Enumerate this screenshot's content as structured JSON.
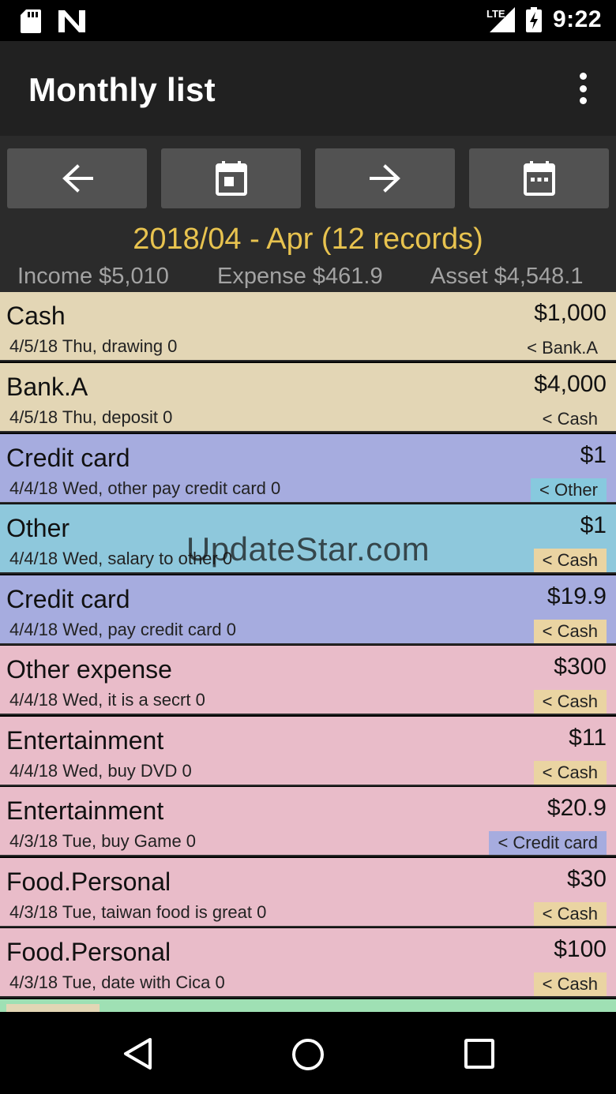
{
  "status_bar": {
    "time": "9:22",
    "network": "LTE",
    "icons": [
      "sd-card-icon",
      "n-logo-icon",
      "signal-icon",
      "battery-charging-icon"
    ]
  },
  "app_bar": {
    "title": "Monthly list",
    "menu_icon": "more-vert-icon"
  },
  "navigation": {
    "buttons": [
      {
        "icon": "arrow-left-icon"
      },
      {
        "icon": "calendar-day-icon"
      },
      {
        "icon": "arrow-right-icon"
      },
      {
        "icon": "calendar-month-icon"
      }
    ]
  },
  "summary": {
    "title": "2018/04 - Apr (12 records)",
    "income": "Income $5,010",
    "expense": "Expense $461.9",
    "asset": "Asset $4,548.1"
  },
  "records": [
    {
      "category": "Cash",
      "amount": "$1,000",
      "detail": "4/5/18 Thu, drawing  0",
      "source": "< Bank.A",
      "row_color": "#e3d6b5",
      "source_color": ""
    },
    {
      "category": "Bank.A",
      "amount": "$4,000",
      "detail": "4/5/18 Thu, deposit  0",
      "source": "< Cash",
      "row_color": "#e3d6b5",
      "source_color": ""
    },
    {
      "category": "Credit card",
      "amount": "$1",
      "detail": "4/4/18 Wed, other pay credit card 0",
      "source": "< Other",
      "row_color": "#a6acdf",
      "source_color": "#87c9de"
    },
    {
      "category": "Other",
      "amount": "$1",
      "detail": "4/4/18 Wed, salary to other 0",
      "source": "< Cash",
      "row_color": "#8ec8dc",
      "source_color": "#ead4a2"
    },
    {
      "category": "Credit card",
      "amount": "$19.9",
      "detail": "4/4/18 Wed, pay credit card 0",
      "source": "< Cash",
      "row_color": "#a6acdf",
      "source_color": "#ead4a2"
    },
    {
      "category": "Other expense",
      "amount": "$300",
      "detail": "4/4/18 Wed, it is a secrt  0",
      "source": "< Cash",
      "row_color": "#e9bcc9",
      "source_color": "#ead4a2"
    },
    {
      "category": "Entertainment",
      "amount": "$11",
      "detail": "4/4/18 Wed, buy DVD 0",
      "source": "< Cash",
      "row_color": "#e9bcc9",
      "source_color": "#ead4a2"
    },
    {
      "category": "Entertainment",
      "amount": "$20.9",
      "detail": "4/3/18 Tue, buy Game 0",
      "source": "< Credit card",
      "row_color": "#e9bcc9",
      "source_color": "#a6acdf"
    },
    {
      "category": "Food.Personal",
      "amount": "$30",
      "detail": "4/3/18 Tue, taiwan food is great 0",
      "source": "< Cash",
      "row_color": "#e9bcc9",
      "source_color": "#ead4a2"
    },
    {
      "category": "Food.Personal",
      "amount": "$100",
      "detail": "4/3/18 Tue, date with Cica 0",
      "source": "< Cash",
      "row_color": "#e9bcc9",
      "source_color": "#ead4a2"
    }
  ],
  "watermark": "UpdateStar.com",
  "nav_bar": {
    "icons": [
      "back-icon",
      "home-icon",
      "recents-icon"
    ]
  }
}
